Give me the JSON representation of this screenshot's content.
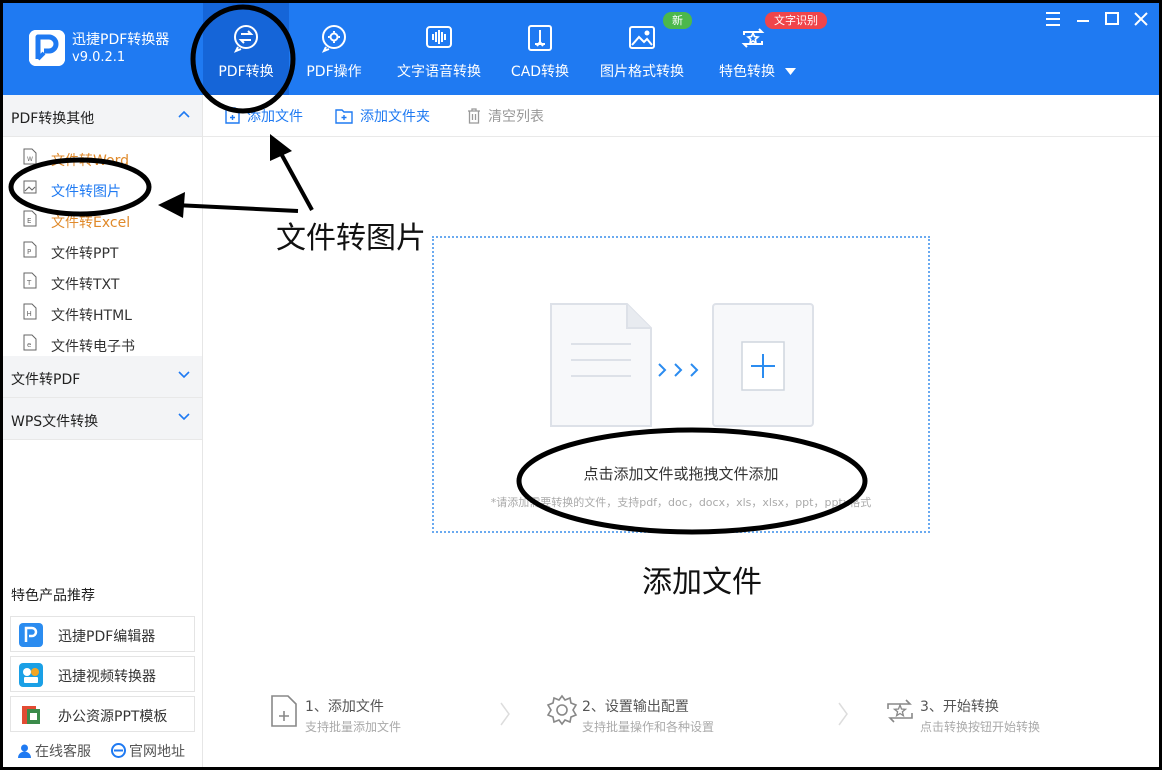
{
  "app": {
    "name": "迅捷PDF转换器",
    "version": "v9.0.2.1",
    "accent_color": "#1f7af2",
    "active_tab_color": "#1565d8"
  },
  "nav": {
    "tabs": [
      {
        "label": "PDF转换",
        "icon": "pdf-convert-icon",
        "active": true
      },
      {
        "label": "PDF操作",
        "icon": "pdf-operation-icon",
        "active": false
      },
      {
        "label": "文字语音转换",
        "icon": "audio-wave-icon",
        "active": false
      },
      {
        "label": "CAD转换",
        "icon": "cad-icon",
        "active": false
      },
      {
        "label": "图片格式转换",
        "icon": "image-icon",
        "active": false,
        "badge": "新",
        "badge_color": "#4cb84c"
      },
      {
        "label": "特色转换",
        "icon": "special-convert-icon",
        "active": false,
        "badge": "文字识别",
        "badge_color": "#f0454a",
        "has_dropdown": true
      }
    ]
  },
  "window_controls": [
    "menu-icon",
    "minimize-icon",
    "maximize-icon",
    "close-icon"
  ],
  "sidebar": {
    "sections": [
      {
        "title": "PDF转换其他",
        "expanded": true,
        "items": [
          {
            "label": "文件转Word",
            "icon": "W",
            "state": "visited"
          },
          {
            "label": "文件转图片",
            "icon": "image",
            "state": "selected"
          },
          {
            "label": "文件转Excel",
            "icon": "E",
            "state": "visited"
          },
          {
            "label": "文件转PPT",
            "icon": "P",
            "state": "normal"
          },
          {
            "label": "文件转TXT",
            "icon": "T",
            "state": "normal"
          },
          {
            "label": "文件转HTML",
            "icon": "H",
            "state": "normal"
          },
          {
            "label": "文件转电子书",
            "icon": "e",
            "state": "normal"
          }
        ]
      },
      {
        "title": "文件转PDF",
        "expanded": false
      },
      {
        "title": "WPS文件转换",
        "expanded": false
      }
    ],
    "promo_title": "特色产品推荐",
    "promos": [
      {
        "label": "迅捷PDF编辑器",
        "icon": "pdf-editor-icon"
      },
      {
        "label": "迅捷视频转换器",
        "icon": "video-converter-icon"
      },
      {
        "label": "办公资源PPT模板",
        "icon": "ppt-template-icon"
      }
    ],
    "footer": {
      "service": "在线客服",
      "website": "官网地址"
    }
  },
  "toolbar": {
    "add_file": "添加文件",
    "add_folder": "添加文件夹",
    "clear_list": "清空列表"
  },
  "dropzone": {
    "hint": "点击添加文件或拖拽文件添加",
    "sub": "*请添加需要转换的文件，支持pdf，doc，docx，xls，xlsx，ppt，pptx格式"
  },
  "steps": [
    {
      "title": "1、添加文件",
      "sub": "支持批量添加文件",
      "icon": "add-file-step-icon"
    },
    {
      "title": "2、设置输出配置",
      "sub": "支持批量操作和各种设置",
      "icon": "settings-gear-icon"
    },
    {
      "title": "3、开始转换",
      "sub": "点击转换按钮开始转换",
      "icon": "start-convert-icon"
    }
  ],
  "annotations": {
    "label_image": "文件转图片",
    "label_add": "添加文件"
  }
}
